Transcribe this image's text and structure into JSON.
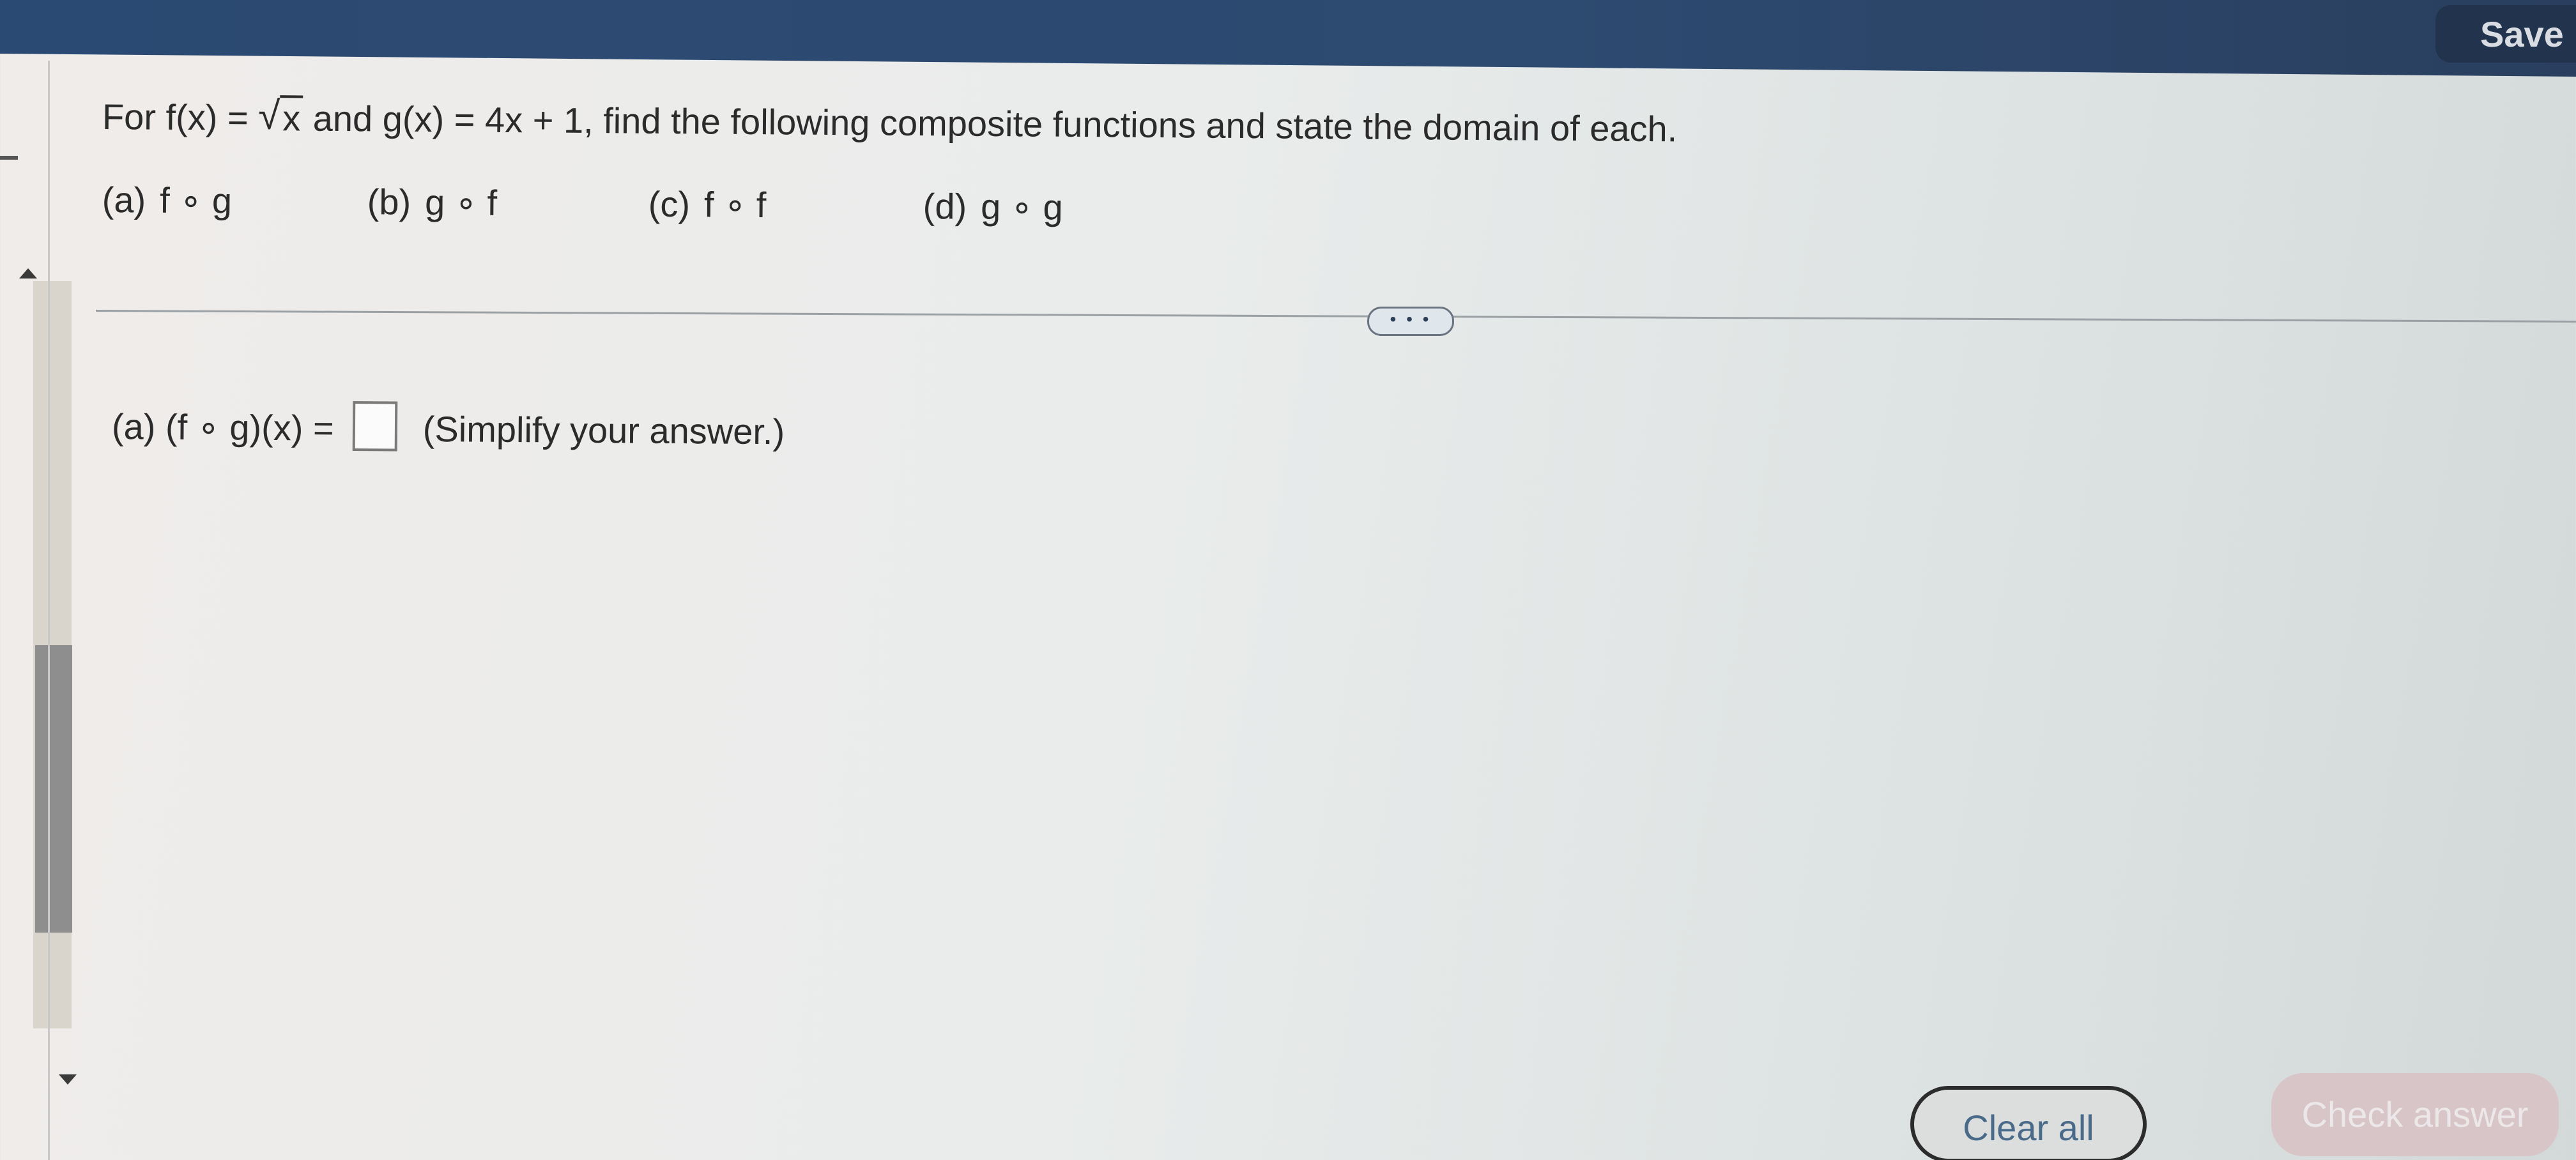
{
  "header": {
    "save_label": "Save"
  },
  "problem": {
    "prompt_before": "For f(x) =",
    "sqrt_arg": "x",
    "prompt_after": "and g(x) = 4x + 1, find the following composite functions and state the domain of each.",
    "parts": [
      {
        "label": "(a)",
        "expr": "f ∘ g"
      },
      {
        "label": "(b)",
        "expr": "g ∘ f"
      },
      {
        "label": "(c)",
        "expr": "f ∘ f"
      },
      {
        "label": "(d)",
        "expr": "g ∘ g"
      }
    ]
  },
  "divider": {
    "more_label": "• • •"
  },
  "answer": {
    "label": "(a) (f ∘ g)(x) =",
    "input_value": "",
    "hint": "(Simplify your answer.)"
  },
  "footer": {
    "clear_label": "Clear all",
    "check_label": "Check answer"
  },
  "colors": {
    "header_bg": "#2b4a73",
    "check_disabled": "#d8c5c8"
  }
}
